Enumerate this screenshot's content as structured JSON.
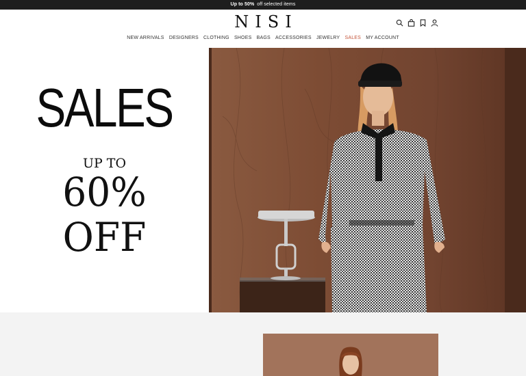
{
  "promo": {
    "strong_text": "Up to 50%",
    "text": "off selected items"
  },
  "header": {
    "logo": "NISI",
    "icons": [
      "search-icon",
      "shopping-bag-icon",
      "bookmark-icon",
      "user-icon"
    ]
  },
  "nav": {
    "items": [
      "NEW ARRIVALS",
      "DESIGNERS",
      "CLOTHING",
      "SHOES",
      "BAGS",
      "ACCESSORIES",
      "JEWELRY",
      "SALES",
      "MY ACCOUNT"
    ],
    "active": "SALES",
    "active_color": "#c4553a"
  },
  "hero": {
    "title": "SALES",
    "upto": "UP TO",
    "percent": "60%",
    "off": "OFF"
  },
  "colors": {
    "promo_bg": "#1e1e1e",
    "lower_bg": "#f3f3f3",
    "wood": "#7a4a33"
  }
}
